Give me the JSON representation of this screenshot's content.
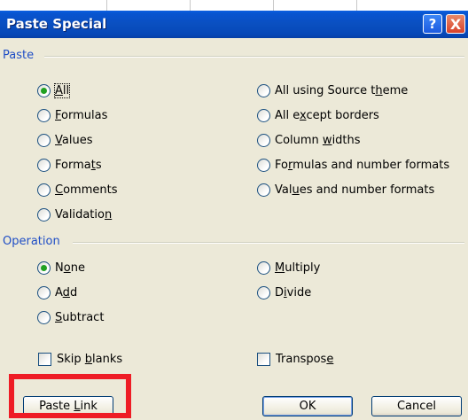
{
  "dialog": {
    "title": "Paste Special",
    "help_label": "?",
    "close_label": "X"
  },
  "paste_section": {
    "label": "Paste",
    "left": [
      {
        "pre": "",
        "mn": "A",
        "post": "ll",
        "checked": true
      },
      {
        "pre": "",
        "mn": "F",
        "post": "ormulas",
        "checked": false
      },
      {
        "pre": "",
        "mn": "V",
        "post": "alues",
        "checked": false
      },
      {
        "pre": "Forma",
        "mn": "t",
        "post": "s",
        "checked": false
      },
      {
        "pre": "",
        "mn": "C",
        "post": "omments",
        "checked": false
      },
      {
        "pre": "Validatio",
        "mn": "n",
        "post": "",
        "checked": false
      }
    ],
    "right": [
      {
        "pre": "All using Source t",
        "mn": "h",
        "post": "eme",
        "checked": false
      },
      {
        "pre": "All e",
        "mn": "x",
        "post": "cept borders",
        "checked": false
      },
      {
        "pre": "Column ",
        "mn": "w",
        "post": "idths",
        "checked": false
      },
      {
        "pre": "Fo",
        "mn": "r",
        "post": "mulas and number formats",
        "checked": false
      },
      {
        "pre": "Val",
        "mn": "u",
        "post": "es and number formats",
        "checked": false
      }
    ]
  },
  "operation_section": {
    "label": "Operation",
    "left": [
      {
        "pre": "N",
        "mn": "o",
        "post": "ne",
        "checked": true
      },
      {
        "pre": "A",
        "mn": "d",
        "post": "d",
        "checked": false
      },
      {
        "pre": "",
        "mn": "S",
        "post": "ubtract",
        "checked": false
      }
    ],
    "right": [
      {
        "pre": "",
        "mn": "M",
        "post": "ultiply",
        "checked": false
      },
      {
        "pre": "D",
        "mn": "i",
        "post": "vide",
        "checked": false
      }
    ]
  },
  "checkboxes": {
    "skip_blanks": {
      "pre": "Skip ",
      "mn": "b",
      "post": "lanks",
      "checked": false
    },
    "transpose": {
      "pre": "Transpos",
      "mn": "e",
      "post": "",
      "checked": false
    }
  },
  "buttons": {
    "paste_link": {
      "pre": "Paste ",
      "mn": "L",
      "post": "ink"
    },
    "ok": "OK",
    "cancel": "Cancel"
  },
  "colors": {
    "section_label": "#1f4ec6",
    "titlebar": "#0a4fc0",
    "radio_checked": "#21a121",
    "highlight": "#ee1c25"
  }
}
